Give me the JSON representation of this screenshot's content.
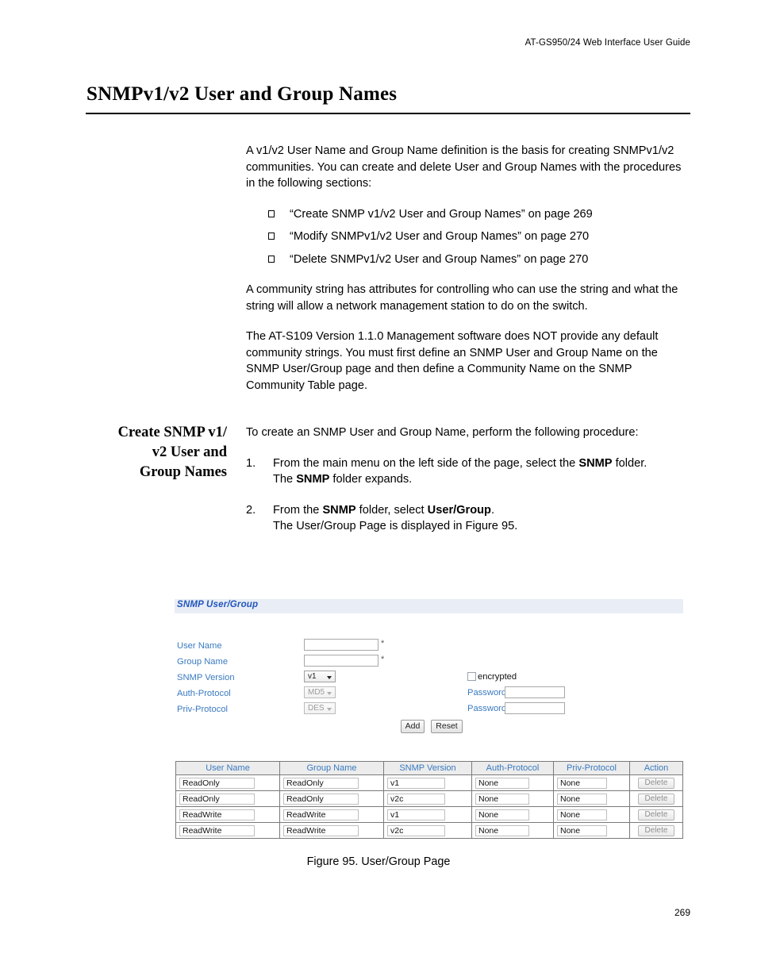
{
  "header": {
    "running_head": "AT-GS950/24  Web Interface User Guide"
  },
  "chapter": {
    "title": "SNMPv1/v2 User and Group Names"
  },
  "intro": {
    "paragraph_1": "A v1/v2 User Name and Group Name definition is the basis for creating SNMPv1/v2 communities. You can create and delete User and Group Names with the procedures in the following sections:",
    "cross_references": [
      "“Create SNMP v1/v2 User and Group Names” on page 269",
      "“Modify SNMPv1/v2 User and Group Names” on page 270",
      "“Delete SNMPv1/v2 User and Group Names” on page 270"
    ],
    "paragraph_2": "A community string has attributes for controlling who can use the string and what the string will allow a network management station to do on the switch.",
    "paragraph_3": "The AT-S109 Version 1.1.0  Management software does NOT provide any default community strings. You must first define an SNMP User and Group Name on the SNMP User/Group page and then define a Community Name on the SNMP Community Table page."
  },
  "section": {
    "sidehead_line_1": "Create SNMP v1/",
    "sidehead_line_2": "v2 User and",
    "sidehead_line_3": "Group Names",
    "lead_in": "To create an SNMP User and Group Name, perform the following procedure:",
    "steps": [
      {
        "number": "1.",
        "line_1_before": "From the main menu on the left side of the page, select the ",
        "line_1_bold": "SNMP",
        "line_1_after": " folder.",
        "line_2_before": "The ",
        "line_2_bold": "SNMP",
        "line_2_after": " folder expands."
      },
      {
        "number": "2.",
        "line_1_before": "From the ",
        "line_1_bold": "SNMP",
        "line_1_mid": " folder, select ",
        "line_1_bold2": "User/Group",
        "line_1_after": ".",
        "line_2": "The User/Group Page is displayed in Figure 95."
      }
    ]
  },
  "figure": {
    "caption": "Figure 95. User/Group Page",
    "panel_title": "SNMP User/Group",
    "form": {
      "user_name_label": "User Name",
      "user_name_value": "",
      "user_name_required_mark": "*",
      "group_name_label": "Group Name",
      "group_name_value": "",
      "group_name_required_mark": "*",
      "snmp_version_label": "SNMP Version",
      "snmp_version_value": "v1",
      "auth_protocol_label": "Auth-Protocol",
      "auth_protocol_value": "MD5",
      "priv_protocol_label": "Priv-Protocol",
      "priv_protocol_value": "DES",
      "encrypted_label": "encrypted",
      "auth_password_label": "Password",
      "auth_password_value": "",
      "priv_password_label": "Password",
      "priv_password_value": "",
      "add_button": "Add",
      "reset_button": "Reset"
    },
    "table": {
      "columns": [
        "User Name",
        "Group Name",
        "SNMP Version",
        "Auth-Protocol",
        "Priv-Protocol",
        "Action"
      ],
      "rows": [
        {
          "user_name": "ReadOnly",
          "group_name": "ReadOnly",
          "snmp_version": "v1",
          "auth_protocol": "None",
          "priv_protocol": "None",
          "action": "Delete"
        },
        {
          "user_name": "ReadOnly",
          "group_name": "ReadOnly",
          "snmp_version": "v2c",
          "auth_protocol": "None",
          "priv_protocol": "None",
          "action": "Delete"
        },
        {
          "user_name": "ReadWrite",
          "group_name": "ReadWrite",
          "snmp_version": "v1",
          "auth_protocol": "None",
          "priv_protocol": "None",
          "action": "Delete"
        },
        {
          "user_name": "ReadWrite",
          "group_name": "ReadWrite",
          "snmp_version": "v2c",
          "auth_protocol": "None",
          "priv_protocol": "None",
          "action": "Delete"
        }
      ]
    }
  },
  "folio": {
    "page_number": "269"
  }
}
